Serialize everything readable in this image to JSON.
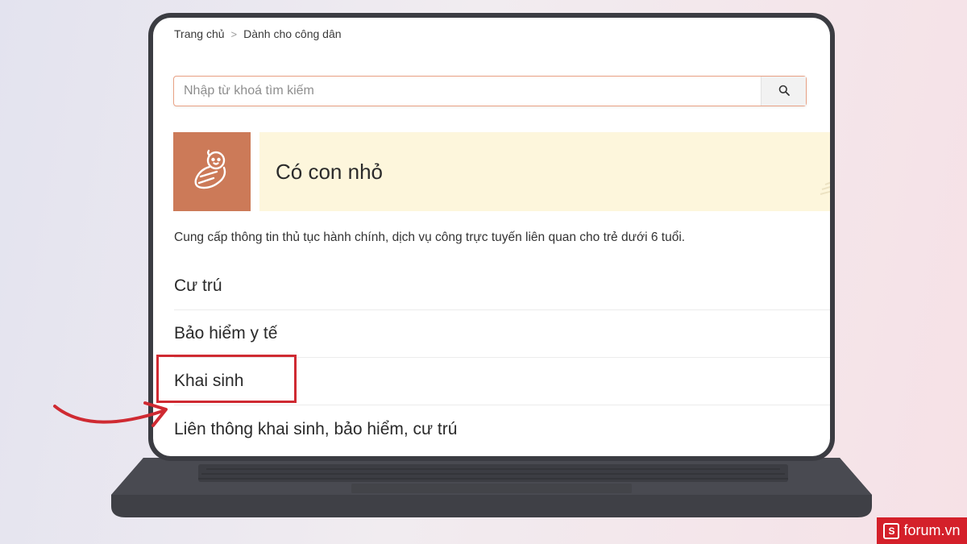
{
  "breadcrumb": {
    "home": "Trang chủ",
    "separator": ">",
    "current": "Dành cho công dân"
  },
  "search": {
    "placeholder": "Nhập từ khoá tìm kiếm",
    "icon": "search-icon"
  },
  "banner": {
    "icon": "baby-icon",
    "title": "Có con nhỏ",
    "icon_bg": "#cc7a58",
    "title_bg": "#fdf6dc"
  },
  "description": "Cung cấp thông tin thủ tục hành chính, dịch vụ công trực tuyến liên quan cho trẻ dưới 6 tuổi.",
  "categories": [
    {
      "label": "Cư trú"
    },
    {
      "label": "Bảo hiểm y tế"
    },
    {
      "label": "Khai sinh"
    },
    {
      "label": "Liên thông khai sinh, bảo hiểm, cư trú"
    }
  ],
  "annotation": {
    "highlighted_item": "Khai sinh",
    "color": "#cf2a32"
  },
  "watermark": {
    "logo_letter": "S",
    "text": "forum.vn"
  }
}
